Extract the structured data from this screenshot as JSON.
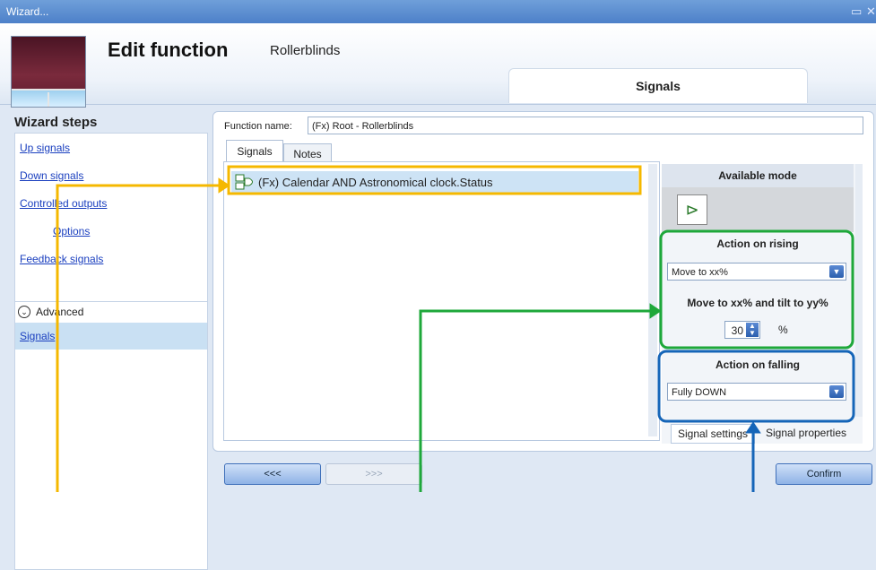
{
  "window": {
    "title": "Wizard...",
    "restore_icon": "restore-icon",
    "close_icon": "close-icon"
  },
  "header": {
    "title": "Edit function",
    "subtitle": "Rollerblinds",
    "tab": "Signals"
  },
  "sidebar": {
    "heading": "Wizard steps",
    "items": [
      {
        "label": "Up signals"
      },
      {
        "label": "Down signals"
      },
      {
        "label": "Controlled outputs"
      },
      {
        "label": "Options"
      },
      {
        "label": "Feedback signals"
      }
    ],
    "advanced_label": "Advanced",
    "selected_item": "Signals"
  },
  "form": {
    "function_name_label": "Function name:",
    "function_name_value": "(Fx) Root - Rollerblinds",
    "tabs": [
      {
        "label": "Signals"
      },
      {
        "label": "Notes"
      }
    ]
  },
  "signal_list": [
    {
      "label": "(Fx) Calendar AND Astronomical clock.Status"
    }
  ],
  "right_panel": {
    "available_mode": "Available mode",
    "action_rising": "Action on rising",
    "rising_value": "Move to xx%",
    "move_label": "Move to xx% and tilt to yy%",
    "percent_value": "30",
    "percent_unit": "%",
    "action_falling": "Action on falling",
    "falling_value": "Fully DOWN",
    "tab_settings": "Signal settings",
    "tab_properties": "Signal properties"
  },
  "buttons": {
    "back": "<<<",
    "next": ">>>",
    "confirm": "Confirm"
  },
  "annotation_colors": {
    "yellow": "#f5b800",
    "green": "#1ea83a",
    "blue": "#1565b8"
  }
}
